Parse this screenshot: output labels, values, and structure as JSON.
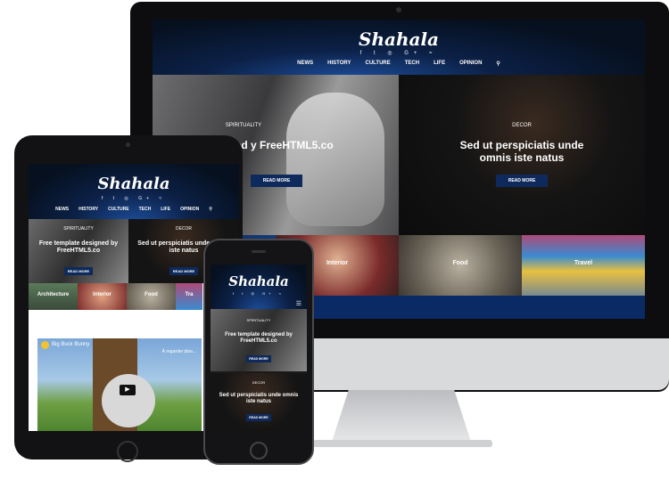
{
  "site": {
    "logo": "Shahala",
    "social_icons": [
      "f",
      "t",
      "◎",
      "G+",
      "≈"
    ],
    "nav": [
      "NEWS",
      "HISTORY",
      "CULTURE",
      "TECH",
      "LIFE",
      "OPINION"
    ],
    "search_icon": "⚲"
  },
  "hero": [
    {
      "category": "SPIRITUALITY",
      "title": "Free template designed by FreeHTML5.co",
      "button": "READ MORE"
    },
    {
      "category": "DECOR",
      "title": "Sed ut perspiciatis unde omnis iste natus",
      "button": "READ MORE"
    }
  ],
  "desktop": {
    "hero_title_left_cropped": "template designed y FreeHTML5.co"
  },
  "strip": [
    "Architecture",
    "Interior",
    "Food",
    "Travel"
  ],
  "tablet": {
    "strip_cropped": [
      "Architecture",
      "Interior",
      "Food",
      "Tra"
    ]
  },
  "video": {
    "title": "Big Buck Bunny",
    "watch_later": "À regarder plus...",
    "play_icon": "▶"
  },
  "phone": {
    "menu_icon": "☰"
  },
  "colors": {
    "header_blue": "#0c2148",
    "button_blue": "#0e2a5c",
    "bezel": "#121214"
  }
}
